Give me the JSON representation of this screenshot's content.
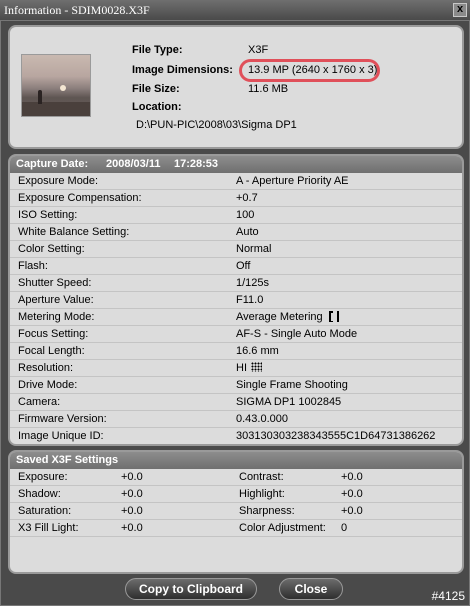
{
  "window": {
    "title": "Information - SDIM0028.X3F",
    "close_glyph": "x"
  },
  "file_info": {
    "file_type_label": "File Type:",
    "file_type_value": "X3F",
    "image_dimensions_label": "Image Dimensions:",
    "image_dimensions_value": "13.9 MP (2640 x 1760 x 3)",
    "file_size_label": "File Size:",
    "file_size_value": "11.6 MB",
    "location_label": "Location:",
    "location_value": "D:\\PUN-PIC\\2008\\03\\Sigma DP1"
  },
  "capture": {
    "header_label": "Capture Date:",
    "date": "2008/03/11",
    "time": "17:28:53",
    "rows": [
      {
        "label": "Exposure Mode:",
        "value": "A - Aperture Priority AE"
      },
      {
        "label": "Exposure Compensation:",
        "value": "+0.7"
      },
      {
        "label": "ISO Setting:",
        "value": "100"
      },
      {
        "label": "White Balance Setting:",
        "value": "Auto"
      },
      {
        "label": "Color Setting:",
        "value": "Normal"
      },
      {
        "label": "Flash:",
        "value": "Off"
      },
      {
        "label": "Shutter Speed:",
        "value": "1/125s"
      },
      {
        "label": "Aperture Value:",
        "value": "F11.0"
      },
      {
        "label": "Metering Mode:",
        "value": "Average Metering"
      },
      {
        "label": "Focus Setting:",
        "value": "AF-S - Single Auto Mode"
      },
      {
        "label": "Focal Length:",
        "value": "16.6 mm"
      },
      {
        "label": "Resolution:",
        "value": "HI"
      },
      {
        "label": "Drive Mode:",
        "value": "Single Frame Shooting"
      },
      {
        "label": "Camera:",
        "value": "SIGMA DP1 1002845"
      },
      {
        "label": "Firmware Version:",
        "value": "0.43.0.000"
      },
      {
        "label": "Image Unique ID:",
        "value": "30313030323834355 5C1D64731386262"
      }
    ]
  },
  "saved": {
    "header_label": "Saved X3F Settings",
    "rows": [
      {
        "l1": "Exposure:",
        "v1": "+0.0",
        "l2": "Contrast:",
        "v2": "+0.0"
      },
      {
        "l1": "Shadow:",
        "v1": "+0.0",
        "l2": "Highlight:",
        "v2": "+0.0"
      },
      {
        "l1": "Saturation:",
        "v1": "+0.0",
        "l2": "Sharpness:",
        "v2": "+0.0"
      },
      {
        "l1": "X3 Fill Light:",
        "v1": "+0.0",
        "l2": "Color Adjustment:",
        "v2": "0"
      }
    ]
  },
  "buttons": {
    "copy_label": "Copy to Clipboard",
    "close_label": "Close"
  },
  "watermark": "#4125",
  "icons": {
    "metering": "average-metering-icon",
    "resolution": "resolution-hi-icon"
  },
  "colors": {
    "highlight_ring": "#e0505a"
  }
}
